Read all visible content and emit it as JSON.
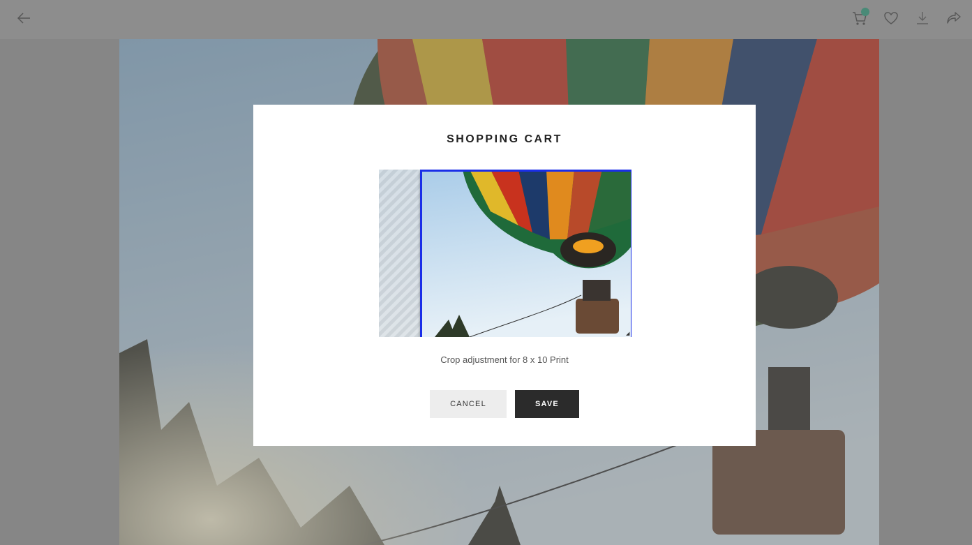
{
  "toolbar": {
    "back_icon": "arrow-left-icon",
    "cart_icon": "shopping-cart-icon",
    "favorite_icon": "heart-icon",
    "download_icon": "download-icon",
    "share_icon": "share-icon",
    "cart_badge_color": "#2aa07f"
  },
  "modal": {
    "title": "SHOPPING CART",
    "caption": "Crop adjustment for 8 x 10 Print",
    "cancel_label": "CANCEL",
    "save_label": "SAVE",
    "crop_frame_color": "#1a2ee8"
  }
}
